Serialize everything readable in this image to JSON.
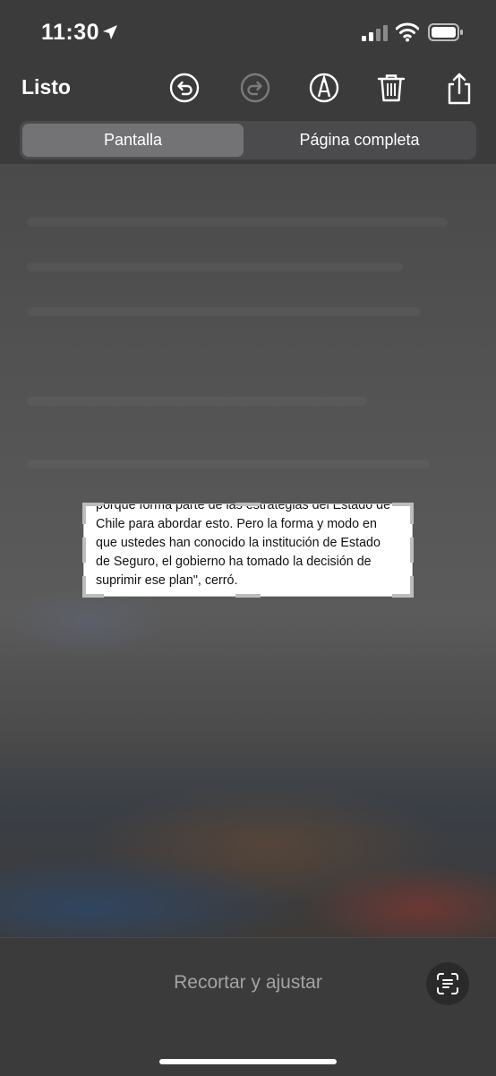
{
  "status_bar": {
    "time": "11:30"
  },
  "toolbar": {
    "done_label": "Listo",
    "icons": [
      "undo-icon",
      "redo-icon",
      "markup-pen-icon",
      "trash-icon",
      "share-icon"
    ]
  },
  "segmented": {
    "options": [
      "Pantalla",
      "Página completa"
    ],
    "selected": "Pantalla"
  },
  "crop_selection": {
    "lines": [
      "porque forma parte de las estrategias del Estado de",
      "Chile para abordar esto. Pero la forma y modo en",
      "que ustedes han conocido la institución de Estado",
      "de Seguro, el gobierno ha tomado la decisión de",
      "suprimir ese plan\", cerró."
    ]
  },
  "bottom_bar": {
    "crop_label": "Recortar y ajustar",
    "icons": [
      "live-text-icon"
    ]
  },
  "colors": {
    "chrome": "#3b3b3b",
    "segment_bg": "#4b4b4d",
    "segment_active": "#737375",
    "muted_text": "#a3a3a3"
  }
}
